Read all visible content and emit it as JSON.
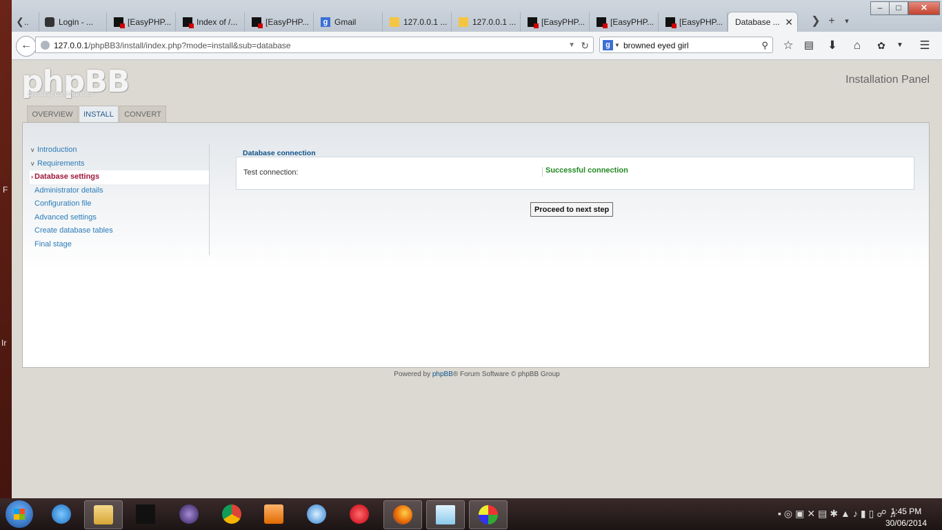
{
  "browser": {
    "tabs": [
      {
        "label": "Login - ...",
        "icon": "lock-icon"
      },
      {
        "label": "[EasyPHP...",
        "icon": "easyphp-icon"
      },
      {
        "label": "Index of /...",
        "icon": "easyphp-icon"
      },
      {
        "label": "[EasyPHP...",
        "icon": "easyphp-icon"
      },
      {
        "label": "Gmail",
        "icon": "google-icon"
      },
      {
        "label": "127.0.0.1 ...",
        "icon": "pma-icon"
      },
      {
        "label": "127.0.0.1 ...",
        "icon": "pma-icon"
      },
      {
        "label": "[EasyPHP...",
        "icon": "easyphp-icon"
      },
      {
        "label": "[EasyPHP...",
        "icon": "easyphp-icon"
      },
      {
        "label": "[EasyPHP...",
        "icon": "easyphp-icon"
      }
    ],
    "first_tab_fragment": "..",
    "active_tab": "Database ...",
    "url_host": "127.0.0.1",
    "url_path": "/phpBB3/install/index.php?mode=install&sub=database",
    "search_value": "browned eyed girl"
  },
  "page": {
    "logo_text": "phpBB",
    "logo_tagline": "creating communities",
    "panel_title": "Installation Panel",
    "nav_tabs": [
      "OVERVIEW",
      "INSTALL",
      "CONVERT"
    ],
    "active_nav_tab": "INSTALL",
    "menu": [
      {
        "label": "Introduction",
        "state": "done"
      },
      {
        "label": "Requirements",
        "state": "done"
      },
      {
        "label": "Database settings",
        "state": "active"
      },
      {
        "label": "Administrator details",
        "state": "todo"
      },
      {
        "label": "Configuration file",
        "state": "todo"
      },
      {
        "label": "Advanced settings",
        "state": "todo"
      },
      {
        "label": "Create database tables",
        "state": "todo"
      },
      {
        "label": "Final stage",
        "state": "todo"
      }
    ],
    "section_title": "Database connection",
    "test_label": "Test connection:",
    "test_result": "Successful connection",
    "proceed_button": "Proceed to next step",
    "footer_prefix": "Powered by ",
    "footer_link": "phpBB",
    "footer_suffix": "® Forum Software © phpBB Group"
  },
  "taskbar": {
    "time": "1:45 PM",
    "date": "30/06/2014"
  },
  "colors": {
    "link": "#2a7bb8",
    "active_menu": "#a0163a",
    "success": "#228822",
    "heading": "#105289"
  }
}
